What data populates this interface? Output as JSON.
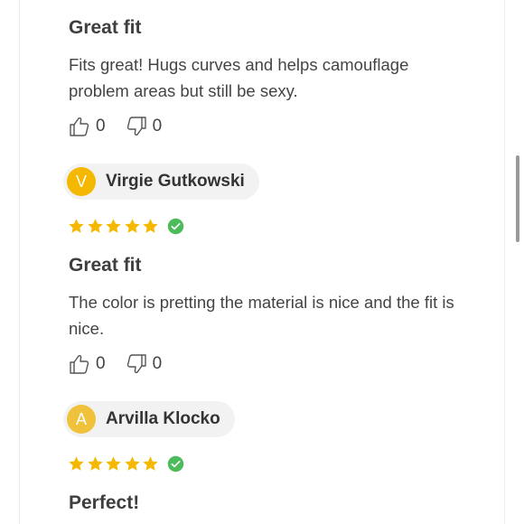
{
  "reviews": [
    {
      "title": "Great fit",
      "body": "Fits great! Hugs curves and helps camouflage problem areas but still be sexy.",
      "likes": "0",
      "dislikes": "0"
    },
    {
      "author_initial": "V",
      "author_name": "Virgie Gutkowski",
      "rating": 5,
      "verified": true,
      "title": "Great fit",
      "body": "The color is pretting the material is nice and the fit is nice.",
      "likes": "0",
      "dislikes": "0"
    },
    {
      "author_initial": "A",
      "author_name": "Arvilla Klocko",
      "rating": 5,
      "verified": true,
      "title": "Perfect!"
    }
  ],
  "colors": {
    "star": "#f5b800",
    "verified": "#4cbb5a",
    "avatar": "#f5b800"
  }
}
